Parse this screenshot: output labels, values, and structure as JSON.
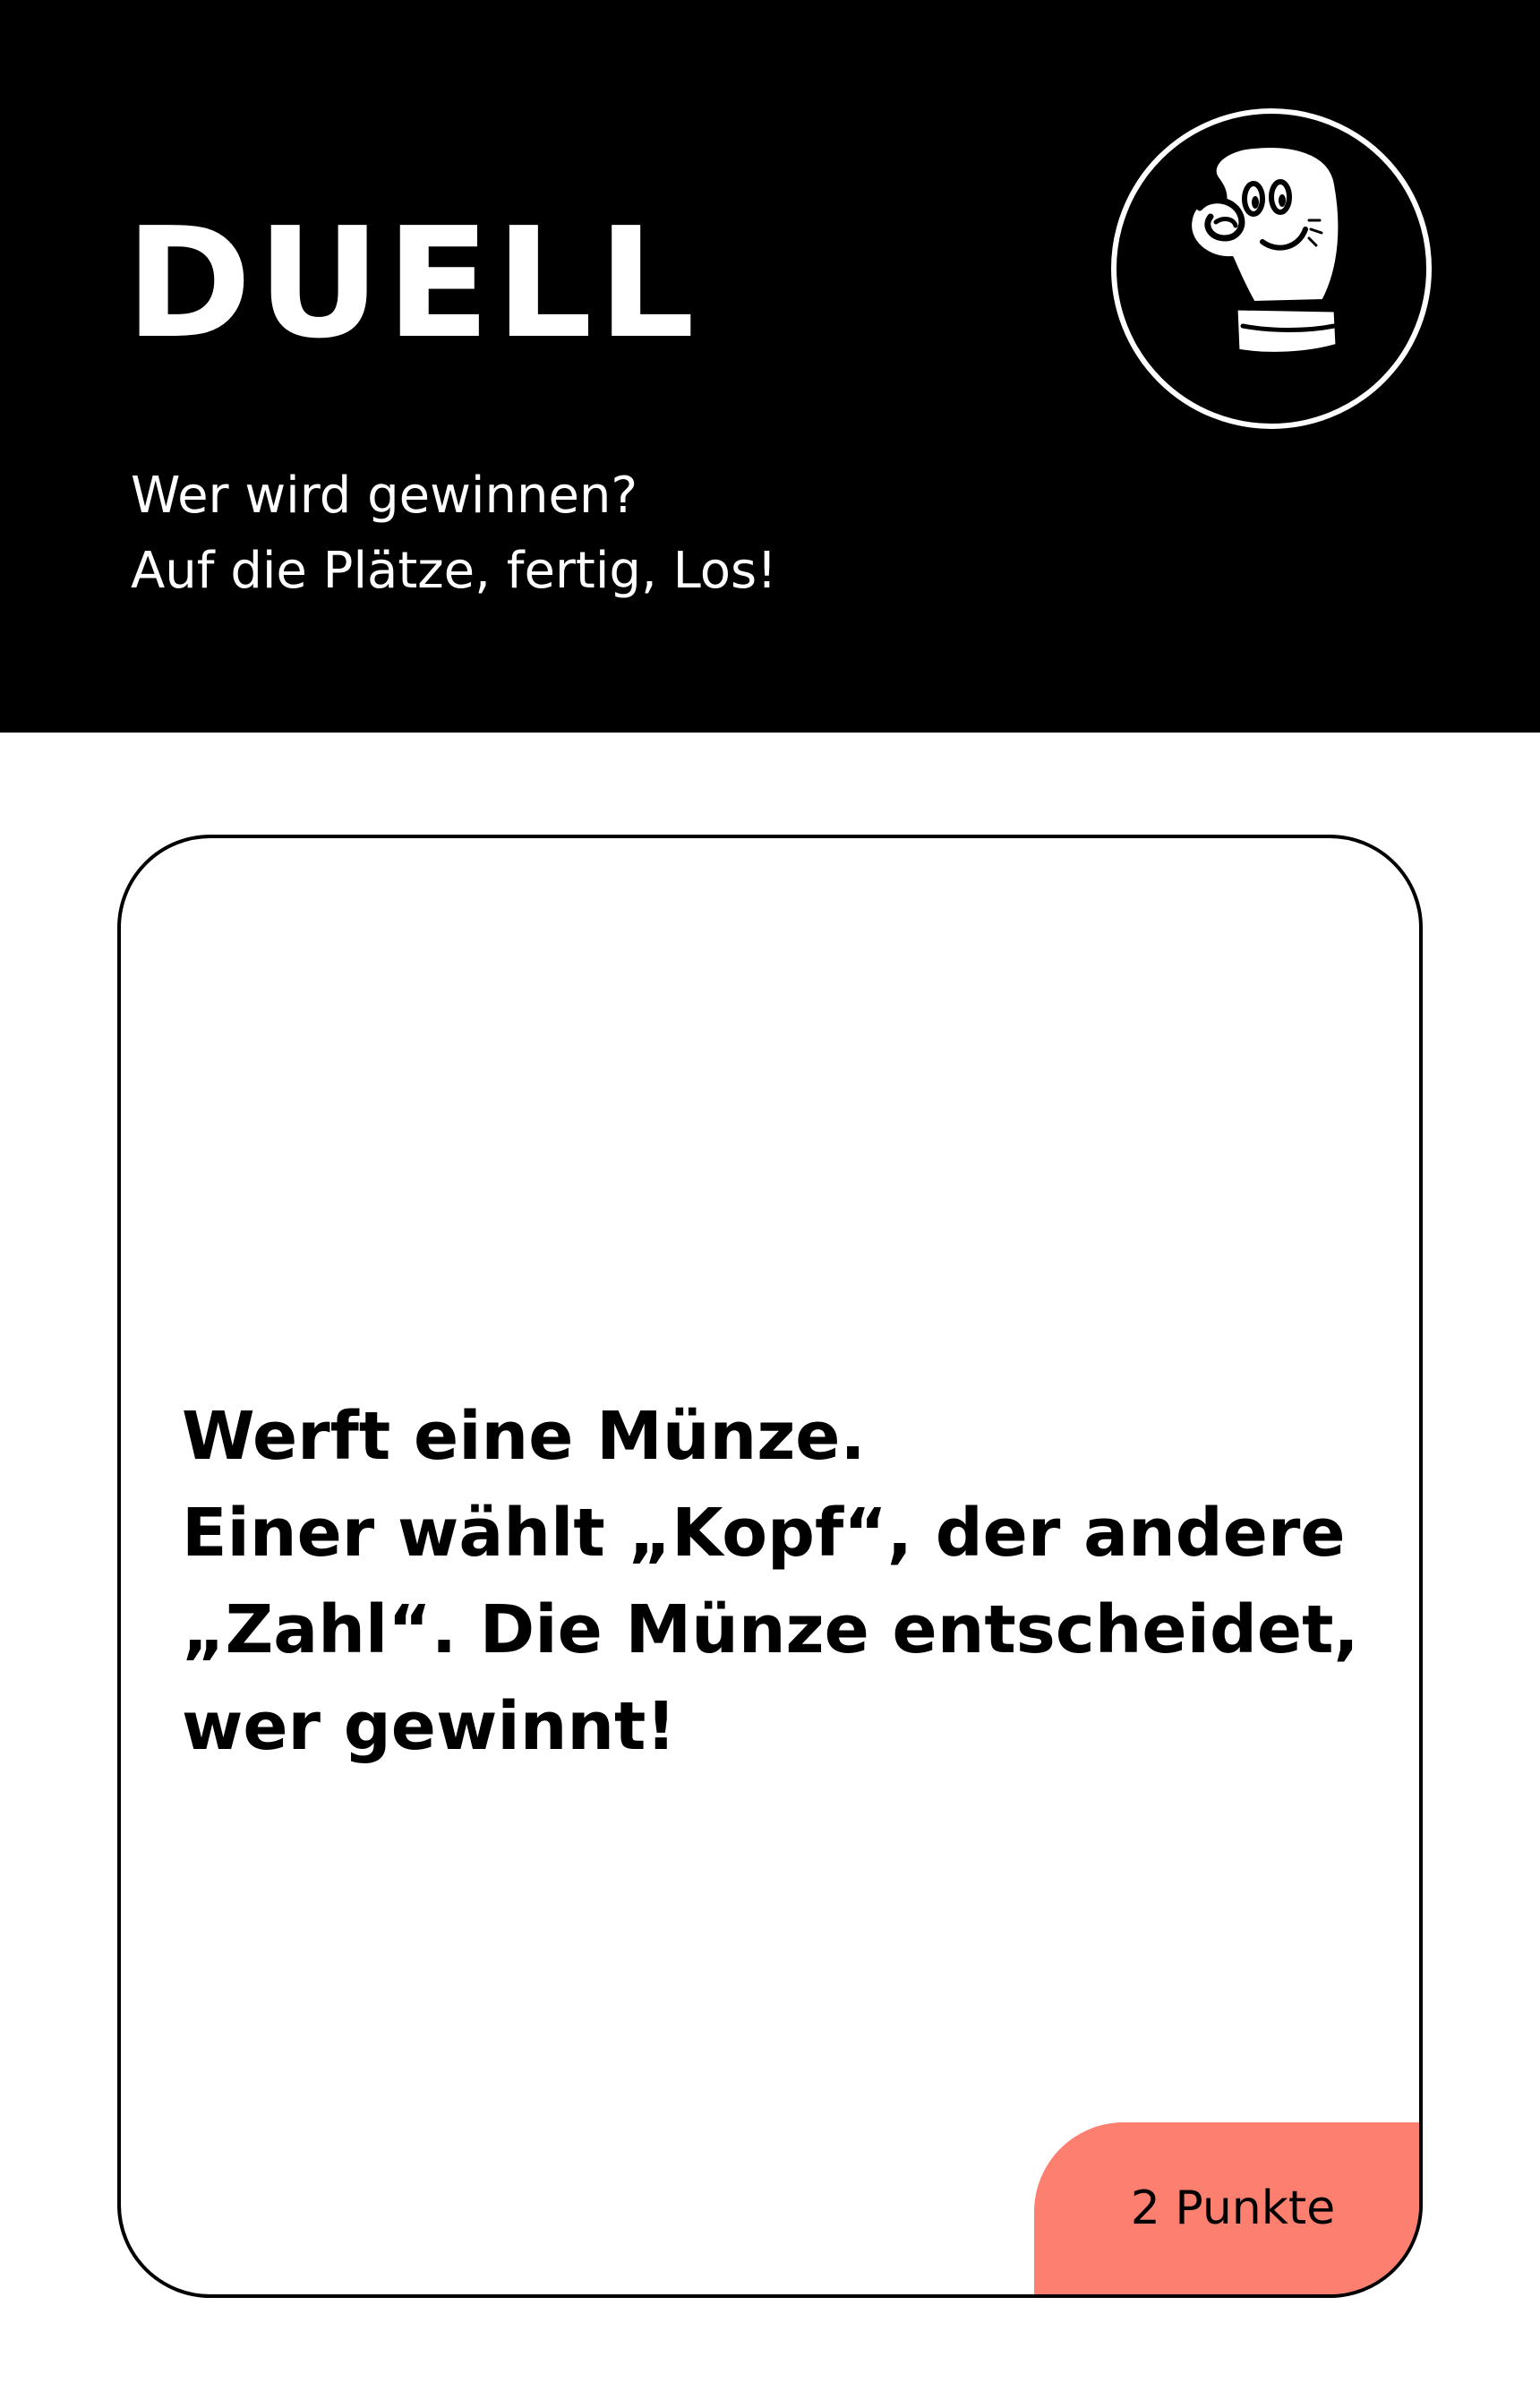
{
  "header": {
    "title": "DUELL",
    "subtitle_lines": [
      "Wer wird gewinnen?",
      "Auf die Plätze, fertig, Los!"
    ],
    "icon": "boxing-glove-icon",
    "background_color": "#000000",
    "text_color": "#ffffff"
  },
  "card": {
    "text_lines": [
      "Werft eine Münze.",
      "Einer wählt „Kopf“, der andere",
      "„Zahl“. Die Münze entscheidet,",
      "wer gewinnt!"
    ],
    "points_label": "2 Punkte",
    "points_color": "#fd7f6f"
  }
}
